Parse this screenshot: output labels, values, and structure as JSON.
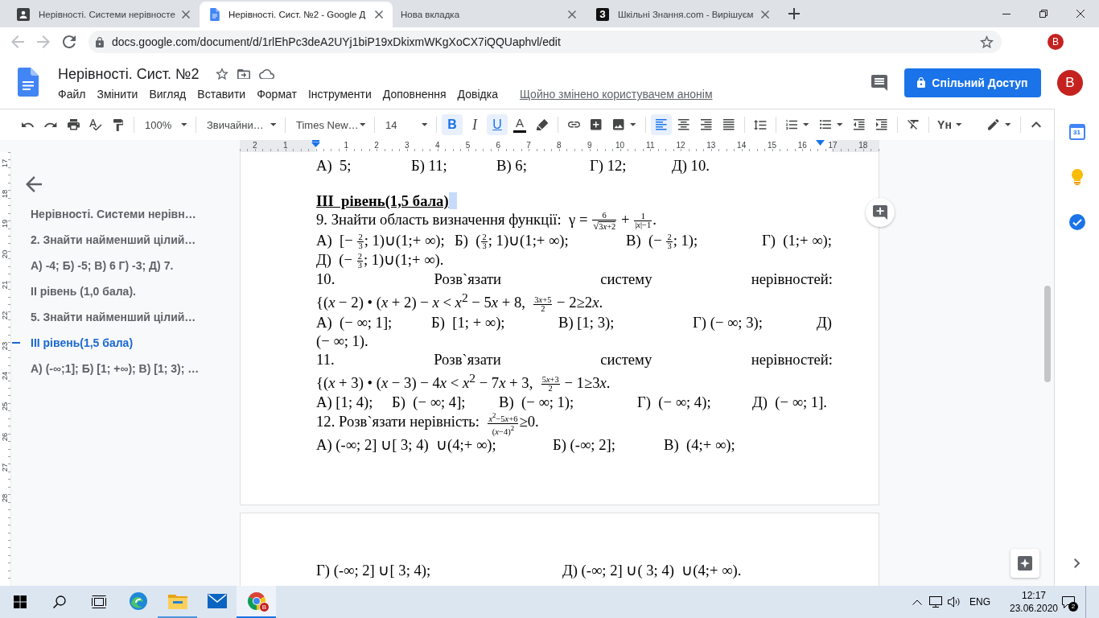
{
  "browser": {
    "tabs": [
      {
        "kind": "card",
        "title": "Нерівності. Системи нерівносте",
        "selected": false
      },
      {
        "kind": "doc",
        "title": "Нерівності. Сист. №2 - Google Д",
        "selected": true
      },
      {
        "kind": "plain",
        "title": "Нова вкладка",
        "selected": false
      },
      {
        "kind": "letter",
        "logo_text": "З",
        "title": "Шкільні Знання.com - Вирішуєм",
        "selected": false
      }
    ],
    "url": "docs.google.com/document/d/1rlEhPc3deA2UYj1biP19xDkixmWKgXoCX7iQQUaphvl/edit",
    "avatar": "B"
  },
  "docs": {
    "title": "Нерівності. Сист. №2",
    "menu": [
      "Файл",
      "Змінити",
      "Вигляд",
      "Вставити",
      "Формат",
      "Інструменти",
      "Доповнення",
      "Довідка"
    ],
    "last_edit": "Щойно змінено користувачем анонім",
    "share": "Спільний Доступ",
    "avatar": "B"
  },
  "toolbar": {
    "zoom": "100%",
    "style": "Звичайни…",
    "font": "Times New…",
    "size": "14",
    "format": [
      {
        "kind": "bold",
        "label": "B",
        "on": true
      },
      {
        "kind": "italic",
        "label": "I",
        "on": false
      },
      {
        "kind": "underline",
        "label": "U",
        "on": true
      }
    ],
    "text_color": "A",
    "alignment": [
      {
        "selected": true
      },
      {
        "selected": false
      },
      {
        "selected": false
      },
      {
        "selected": false
      }
    ],
    "input_tools": "Yн"
  },
  "ruler": {
    "left_marks": [
      "2",
      "1"
    ],
    "marks": [
      "1",
      "2",
      "3",
      "4",
      "5",
      "6",
      "7",
      "8",
      "9",
      "10",
      "11",
      "12",
      "13",
      "14",
      "15",
      "16",
      "17",
      "18"
    ],
    "side_marks": [
      "17",
      "18",
      "19",
      "20",
      "21",
      "22",
      "23",
      "24",
      "25",
      "26",
      "27",
      "28"
    ]
  },
  "outline": {
    "items": [
      {
        "text": "Нерівності. Системи нерівн…",
        "selected": false
      },
      {
        "text": "2. Знайти найменший цілий…",
        "selected": false
      },
      {
        "text": "А) -4; Б) -5; В) 6 Г) -3; Д) 7.",
        "selected": false
      },
      {
        "text": "II рівень (1,0 бала).",
        "selected": false
      },
      {
        "text": "5. Знайти найменший цілий…",
        "selected": false
      },
      {
        "text": "III рівень(1,5 бала)",
        "selected": true
      },
      {
        "text": "А) (-∞;1]; Б) [1; +∞); В) [1; 3); …",
        "selected": false
      }
    ]
  },
  "page": {
    "lines": [
      {
        "kind": "options",
        "items": [
          [
            {
              "kind": "text",
              "text": "А)  5;"
            }
          ],
          [
            {
              "kind": "text",
              "text": "Б) 11;"
            }
          ],
          [
            {
              "kind": "text",
              "text": "В) 6;"
            }
          ],
          [
            {
              "kind": "text",
              "text": "Г) 12;"
            }
          ],
          [
            {
              "kind": "text",
              "text": "Д) 10."
            }
          ]
        ]
      },
      {
        "kind": "heading",
        "text": "III  рівень(1,5 бала)",
        "selection": true
      },
      {
        "kind": "question",
        "parts": [
          {
            "kind": "text",
            "text": "9. Знайти область визначення функції:  γ = "
          },
          {
            "kind": "frac",
            "num": [
              {
                "kind": "text",
                "text": "6"
              }
            ],
            "den": [
              {
                "kind": "root",
                "sign": "√",
                "parts": [
                  {
                    "kind": "text",
                    "text": "3"
                  },
                  {
                    "kind": "var",
                    "text": "x"
                  },
                  {
                    "kind": "text",
                    "text": "+2"
                  }
                ]
              }
            ]
          },
          {
            "kind": "text",
            "text": " + "
          },
          {
            "kind": "frac",
            "num": [
              {
                "kind": "text",
                "text": "1"
              }
            ],
            "den": [
              {
                "kind": "text",
                "text": "|*x*|−1"
              }
            ]
          },
          {
            "kind": "text",
            "text": "."
          }
        ]
      },
      {
        "kind": "options",
        "items": [
          [
            {
              "kind": "text",
              "text": "А)  [− "
            },
            {
              "kind": "frac",
              "num": [
                {
                  "kind": "text",
                  "text": "2"
                }
              ],
              "den": [
                {
                  "kind": "text",
                  "text": "3"
                }
              ]
            },
            {
              "kind": "text",
              "text": "; 1)∪(1;+ ∞);"
            }
          ],
          [
            {
              "kind": "text",
              "text": "Б)  ("
            },
            {
              "kind": "frac",
              "num": [
                {
                  "kind": "text",
                  "text": "2"
                }
              ],
              "den": [
                {
                  "kind": "text",
                  "text": "3"
                }
              ]
            },
            {
              "kind": "text",
              "text": "; 1)∪(1;+ ∞);"
            }
          ],
          [
            {
              "kind": "text",
              "text": "В)  (− "
            },
            {
              "kind": "frac",
              "num": [
                {
                  "kind": "text",
                  "text": "2"
                }
              ],
              "den": [
                {
                  "kind": "text",
                  "text": "3"
                }
              ]
            },
            {
              "kind": "text",
              "text": "; 1);"
            }
          ],
          [
            {
              "kind": "text",
              "text": "Г)  (1;+ ∞);"
            }
          ]
        ]
      },
      {
        "kind": "options",
        "items": [
          [
            {
              "kind": "text",
              "text": "Д)  (− "
            },
            {
              "kind": "frac",
              "num": [
                {
                  "kind": "text",
                  "text": "2"
                }
              ],
              "den": [
                {
                  "kind": "text",
                  "text": "3"
                }
              ]
            },
            {
              "kind": "text",
              "text": "; 1)∪(1;+ ∞)."
            }
          ]
        ]
      },
      {
        "kind": "spread",
        "words": [
          "10.",
          "Розв`язати",
          "систему",
          "нерівностей:"
        ]
      },
      {
        "kind": "formula",
        "parts": [
          {
            "kind": "text",
            "text": "{(*x* − 2) • (*x* + 2) − *x* < *x*$^{2}$ − 5"
          },
          {
            "kind": "var",
            "text": "x"
          },
          {
            "kind": "text",
            "text": " + 8,  "
          },
          {
            "kind": "frac",
            "num": [
              {
                "kind": "text",
                "text": "3"
              },
              {
                "kind": "var",
                "text": "x"
              },
              {
                "kind": "text",
                "text": "+5"
              }
            ],
            "den": [
              {
                "kind": "text",
                "text": "2"
              }
            ]
          },
          {
            "kind": "text",
            "text": " − 2≥2"
          },
          {
            "kind": "var",
            "text": "x"
          },
          {
            "kind": "text",
            "text": "."
          }
        ]
      },
      {
        "kind": "options",
        "items": [
          [
            {
              "kind": "text",
              "text": "А)  (− ∞; 1];"
            }
          ],
          [
            {
              "kind": "text",
              "text": "Б)  [1; + ∞);"
            }
          ],
          [
            {
              "kind": "text",
              "text": "В) [1; 3);"
            }
          ],
          [
            {
              "kind": "text",
              "text": "Г) (− ∞; 3);"
            }
          ],
          [
            {
              "kind": "text",
              "text": "Д)"
            }
          ]
        ]
      },
      {
        "kind": "options",
        "items": [
          [
            {
              "kind": "text",
              "text": "(− ∞; 1)."
            }
          ]
        ]
      },
      {
        "kind": "spread",
        "words": [
          "11.",
          "Розв`язати",
          "систему",
          "нерівностей:"
        ]
      },
      {
        "kind": "formula",
        "parts": [
          {
            "kind": "text",
            "text": "{(*x* + 3) • (*x* − 3) − 4"
          },
          {
            "kind": "var",
            "text": "x"
          },
          {
            "kind": "text",
            "text": " < *x*$^{2}$ − 7"
          },
          {
            "kind": "var",
            "text": "x"
          },
          {
            "kind": "text",
            "text": " + 3,  "
          },
          {
            "kind": "frac",
            "num": [
              {
                "kind": "text",
                "text": "5"
              },
              {
                "kind": "var",
                "text": "x"
              },
              {
                "kind": "text",
                "text": "+3"
              }
            ],
            "den": [
              {
                "kind": "text",
                "text": "2"
              }
            ]
          },
          {
            "kind": "text",
            "text": " − 1≥3"
          },
          {
            "kind": "var",
            "text": "x"
          },
          {
            "kind": "text",
            "text": "."
          }
        ]
      },
      {
        "kind": "options",
        "items": [
          [
            {
              "kind": "text",
              "text": "А) [1; 4);"
            }
          ],
          [
            {
              "kind": "text",
              "text": "Б)  (− ∞; 4];"
            }
          ],
          [
            {
              "kind": "text",
              "text": "В)  (− ∞; 1);"
            }
          ],
          [
            {
              "kind": "text",
              "text": "Г)  (− ∞; 4);"
            }
          ],
          [
            {
              "kind": "text",
              "text": "Д)  (− ∞; 1]."
            }
          ]
        ]
      },
      {
        "kind": "question",
        "parts": [
          {
            "kind": "text",
            "text": "12. Розв`язати нерівність:  "
          },
          {
            "kind": "frac",
            "num": [
              {
                "kind": "text",
                "text": "*x*$^{2}$−5"
              },
              {
                "kind": "var",
                "text": "x"
              },
              {
                "kind": "text",
                "text": "+6"
              }
            ],
            "den": [
              {
                "kind": "text",
                "text": "(*x*−4)$^{2}$"
              }
            ]
          },
          {
            "kind": "text",
            "text": "≥0."
          }
        ]
      },
      {
        "kind": "options",
        "items": [
          [
            {
              "kind": "text",
              "text": "А) (-∞; 2] ∪[ 3; 4)  ∪(4;+ ∞);"
            }
          ],
          [
            {
              "kind": "text",
              "text": "Б) (-∞; 2];"
            }
          ],
          [
            {
              "kind": "text",
              "text": "В)  (4;+ ∞);"
            }
          ]
        ]
      }
    ]
  },
  "next_page": {
    "lines": [
      {
        "kind": "options",
        "items": [
          [
            {
              "kind": "text",
              "text": "Г) (-∞; 2] ∪[ 3; 4);"
            }
          ],
          [
            {
              "kind": "text",
              "text": "Д) (-∞; 2] ∪( 3; 4)  ∪(4;+ ∞)."
            }
          ]
        ]
      }
    ]
  },
  "side_panel": {
    "calendar_day": "31"
  },
  "taskbar": {
    "apps": [
      {
        "running": false,
        "selected": false
      },
      {
        "running": true,
        "selected": false
      },
      {
        "running": false,
        "selected": false
      },
      {
        "running": true,
        "selected": true
      }
    ],
    "app_badge": "B",
    "language": "ENG",
    "time": "12:17",
    "date": "23.06.2020",
    "notifications": "2"
  }
}
